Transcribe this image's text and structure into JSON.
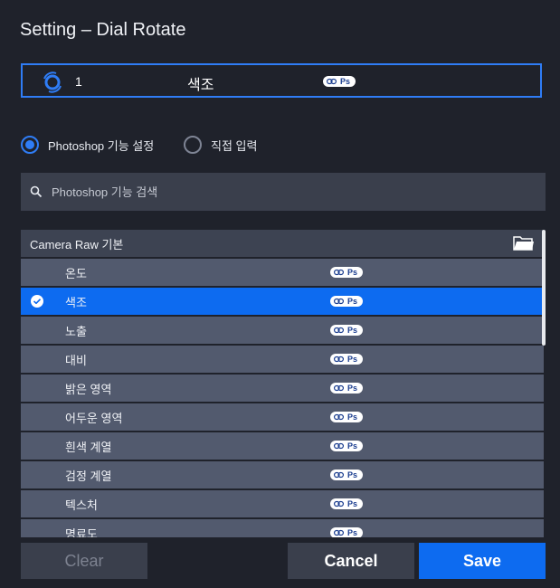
{
  "window": {
    "title": "Setting – Dial Rotate"
  },
  "assignment": {
    "number": "1",
    "function_name": "색조",
    "badge": "Ps"
  },
  "mode": {
    "options": [
      {
        "label": "Photoshop 기능 설정",
        "selected": true
      },
      {
        "label": "직접 입력",
        "selected": false
      }
    ]
  },
  "search": {
    "placeholder": "Photoshop 기능 검색",
    "value": ""
  },
  "category": {
    "title": "Camera Raw 기본"
  },
  "items": [
    {
      "label": "온도",
      "badge": "Ps",
      "selected": false
    },
    {
      "label": "색조",
      "badge": "Ps",
      "selected": true
    },
    {
      "label": "노출",
      "badge": "Ps",
      "selected": false
    },
    {
      "label": "대비",
      "badge": "Ps",
      "selected": false
    },
    {
      "label": "밝은 영역",
      "badge": "Ps",
      "selected": false
    },
    {
      "label": "어두운 영역",
      "badge": "Ps",
      "selected": false
    },
    {
      "label": "흰색 계열",
      "badge": "Ps",
      "selected": false
    },
    {
      "label": "검정 계열",
      "badge": "Ps",
      "selected": false
    },
    {
      "label": "텍스처",
      "badge": "Ps",
      "selected": false
    },
    {
      "label": "명료도",
      "badge": "Ps",
      "selected": false
    }
  ],
  "buttons": {
    "clear": "Clear",
    "cancel": "Cancel",
    "save": "Save"
  },
  "colors": {
    "accent": "#0d6bf0",
    "background": "#1f222b",
    "row": "#525a6e"
  }
}
